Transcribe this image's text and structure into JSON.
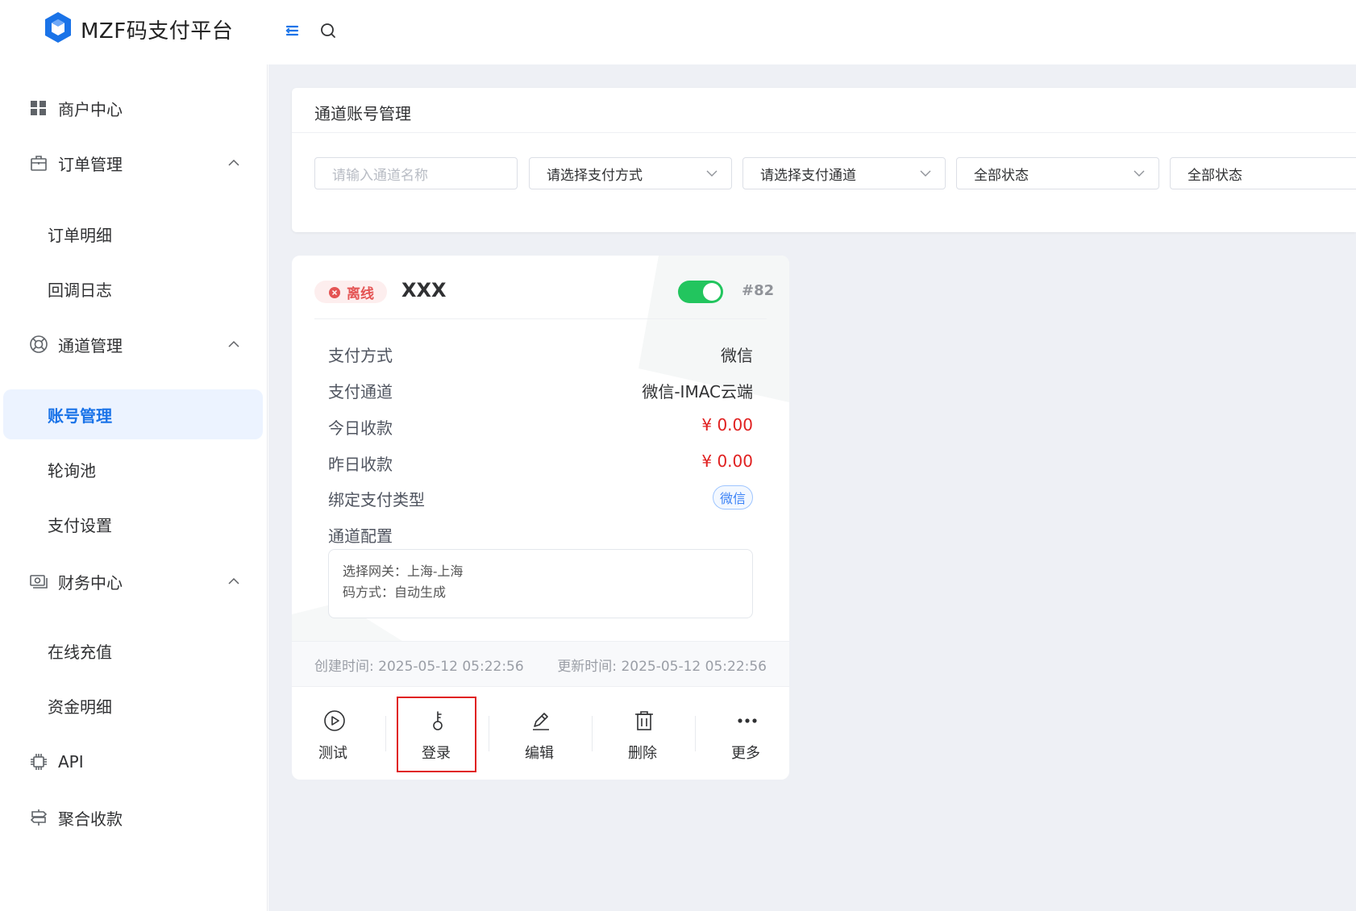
{
  "header": {
    "brand": "MZF码支付平台",
    "icons": [
      "menu-fold-icon",
      "search-icon"
    ],
    "brand_color": "#1a73e8"
  },
  "sidebar": {
    "groups": [
      {
        "label": "商户中心",
        "icon": "dashboard-grid-icon"
      },
      {
        "label": "订单管理",
        "icon": "briefcase-icon",
        "expanded": true,
        "children": [
          "订单明细",
          "回调日志"
        ]
      },
      {
        "label": "通道管理",
        "icon": "lifebuoy-icon",
        "expanded": true,
        "children": [
          "账号管理",
          "轮询池",
          "支付设置"
        ]
      },
      {
        "label": "财务中心",
        "icon": "money-icon",
        "expanded": true,
        "children": [
          "在线充值",
          "资金明细"
        ]
      },
      {
        "label": "API",
        "icon": "chip-icon"
      },
      {
        "label": "聚合收款",
        "icon": "signpost-icon"
      }
    ],
    "active": "账号管理"
  },
  "panel": {
    "title": "通道账号管理",
    "filters": {
      "name_placeholder": "请输入通道名称",
      "pay_method": "请选择支付方式",
      "pay_channel": "请选择支付通道",
      "status1": "全部状态",
      "status2": "全部状态"
    }
  },
  "card": {
    "status": "离线",
    "name": "XXX",
    "enabled": true,
    "id": "#82",
    "rows": [
      {
        "label": "支付方式",
        "value": "微信"
      },
      {
        "label": "支付通道",
        "value": "微信-IMAC云端"
      },
      {
        "label": "今日收款",
        "value": "¥ 0.00"
      },
      {
        "label": "昨日收款",
        "value": "¥ 0.00"
      }
    ],
    "bind_label": "绑定支付类型",
    "bind_value": "微信",
    "config_label": "通道配置",
    "config_lines": [
      "选择网关：上海-上海",
      "码方式：自动生成"
    ],
    "created": "创建时间: 2025-05-12 05:22:56",
    "updated": "更新时间: 2025-05-12 05:22:56",
    "actions": [
      {
        "label": "测试",
        "icon": "play-circle-icon"
      },
      {
        "label": "登录",
        "icon": "key-icon"
      },
      {
        "label": "编辑",
        "icon": "edit-pen-icon"
      },
      {
        "label": "删除",
        "icon": "trash-icon"
      },
      {
        "label": "更多",
        "icon": "more-dots-icon"
      }
    ],
    "colors": {
      "offline": "#e45454",
      "toggle_on": "#22c55e",
      "money": "#e02020",
      "highlight": "#e02020"
    }
  }
}
